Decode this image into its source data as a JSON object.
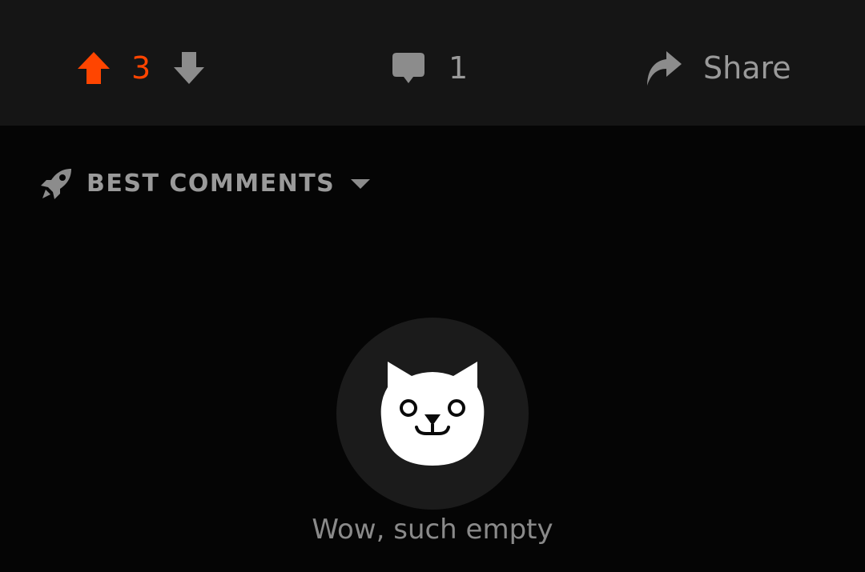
{
  "post_actions": {
    "score": "3",
    "comment_count": "1",
    "share_label": "Share",
    "upvote_icon": "arrow-up-icon",
    "downvote_icon": "arrow-down-icon",
    "comment_icon": "speech-bubble-icon",
    "share_icon": "share-arrow-icon",
    "upvoted": true,
    "accent_color": "#ff4500",
    "muted_color": "#9a9a9a"
  },
  "comments_sort": {
    "label": "BEST COMMENTS",
    "icon": "rocket-icon",
    "dropdown_icon": "caret-down-icon"
  },
  "empty_state": {
    "icon": "cat-face-icon",
    "message": "Wow, such empty"
  }
}
